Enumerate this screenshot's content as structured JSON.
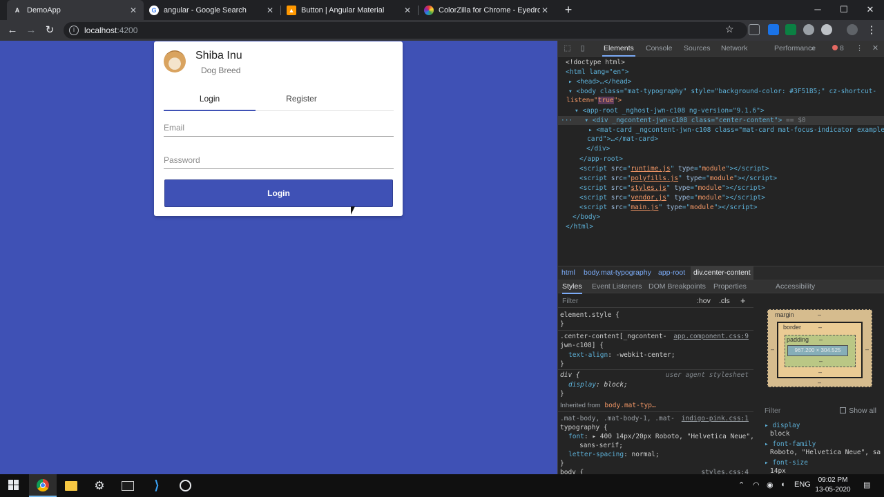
{
  "browser": {
    "tabs": [
      {
        "title": "DemoApp",
        "icon": "angular-icon",
        "active": true
      },
      {
        "title": "angular - Google Search",
        "icon": "google-icon",
        "active": false
      },
      {
        "title": "Button | Angular Material",
        "icon": "angular-material-icon",
        "active": false
      },
      {
        "title": "ColorZilla for Chrome - Eyedropp",
        "icon": "colorzilla-icon",
        "active": false
      }
    ],
    "new_tab_label": "+",
    "address": {
      "host": "localhost",
      "port": ":4200"
    }
  },
  "app": {
    "background": "#3F51B5",
    "card": {
      "title": "Shiba Inu",
      "subtitle": "Dog Breed",
      "tabs": [
        {
          "label": "Login"
        },
        {
          "label": "Register"
        }
      ],
      "email_placeholder": "Email",
      "password_placeholder": "Password",
      "submit_label": "Login"
    }
  },
  "devtools": {
    "tabs": [
      "Elements",
      "Console",
      "Sources",
      "Network",
      "Performance",
      "»"
    ],
    "active_tab": "Elements",
    "error_count": "8",
    "dom": {
      "doctype": "<!doctype html>",
      "html_open": "<html lang=\"en\">",
      "head": "<head>…</head>",
      "body_open_a": "<body class=\"mat-typography\" style=\"background-color: #3F51B5;\" cz-shortcut-",
      "body_open_b_pre": "listen=\"",
      "body_open_b_hl": "true",
      "body_open_b_post": "\">",
      "approot_open": "<app-root _nghost-jwn-c108 ng-version=\"9.1.6\">",
      "div_open": "<div _ngcontent-jwn-c108 class=\"center-content\">",
      "div_suffix": "== $0",
      "matcard_a": "<mat-card _ngcontent-jwn-c108 class=\"mat-card mat-focus-indicator example-",
      "matcard_b": "card\">…</mat-card>",
      "div_close": "</div>",
      "approot_close": "</app-root>",
      "scripts": [
        {
          "src": "runtime.js"
        },
        {
          "src": "polyfills.js"
        },
        {
          "src": "styles.js"
        },
        {
          "src": "vendor.js"
        },
        {
          "src": "main.js"
        }
      ],
      "body_close": "</body>",
      "html_close": "</html>"
    },
    "breadcrumbs": [
      "html",
      "body.mat-typography",
      "app-root",
      "div.center-content"
    ],
    "subtabs": [
      "Styles",
      "Event Listeners",
      "DOM Breakpoints",
      "Properties",
      "Accessibility"
    ],
    "styles": {
      "filter_placeholder": "Filter",
      "hov": ":hov",
      "cls": ".cls",
      "add": "+",
      "element_style": "element.style {",
      "rule1_selector_a": ".center-content[_ngcontent-",
      "rule1_selector_b": "jwn-c108] {",
      "rule1_source": "app.component.css:9",
      "rule1_prop": "text-align",
      "rule1_val": "-webkit-center;",
      "rule2_selector": "div {",
      "rule2_source": "user agent stylesheet",
      "rule2_prop": "display",
      "rule2_val": "block;",
      "inherited_label": "Inherited from",
      "inherited_from": "body.mat-typ…",
      "rule3_selector_a": ".mat-body, .mat-body-1, .mat-",
      "rule3_selector_b": "typography {",
      "rule3_source": "indigo-pink.css:1",
      "rule3_font_prop": "font",
      "rule3_font_val_a": "400 14px/20px Roboto, \"Helvetica Neue\",",
      "rule3_font_val_b": "sans-serif;",
      "rule3_ls_prop": "letter-spacing",
      "rule3_ls_val": "normal;",
      "next_selector": "body {",
      "next_source": "styles.css:4"
    },
    "box_model": {
      "margin_label": "margin",
      "border_label": "border",
      "padding_label": "padding",
      "content_size": "967.200 × 304.525",
      "dash": "–"
    },
    "computed": {
      "filter_placeholder": "Filter",
      "show_all": "Show all",
      "items": [
        {
          "prop": "display",
          "val": "block"
        },
        {
          "prop": "font-family",
          "val": "Roboto, \"Helvetica Neue\", sa"
        },
        {
          "prop": "font-size",
          "val": "14px"
        }
      ]
    }
  },
  "taskbar": {
    "time": "09:02 PM",
    "date": "13-05-2020",
    "lang": "ENG"
  }
}
